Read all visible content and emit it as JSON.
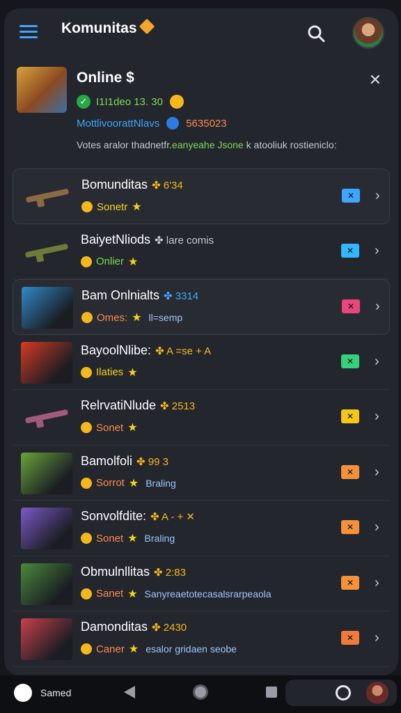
{
  "header": {
    "title": "Komunitas",
    "menu_icon": "hamburger-menu-icon",
    "search_icon": "search-icon",
    "avatar": "user-avatar"
  },
  "online_card": {
    "title": "Online $",
    "stat": "I1I1deo 13. 30",
    "sub_blue": "MottlivoorattNlavs",
    "sub_orange": "5635023",
    "desc_main": "Votes aralor thadnetfr.",
    "desc_green": "eanyeahe Jsone",
    "desc_tail": " k atooliuk rostieniclo:"
  },
  "rows": [
    {
      "title": "Bomunditas",
      "badge": "✤ 6'34",
      "badge_color": "#f5b81c",
      "sub": "Sonetr",
      "sub_color": "#f5d21c",
      "extra": "",
      "tag": "✕",
      "tag_color": "#3ea6ff",
      "thumb": "weapon",
      "thumb_color": "#8b6a45",
      "boxed": true
    },
    {
      "title": "BaiyetNliods",
      "badge": "✤ lare comis",
      "badge_color": "#c5c8d0",
      "sub": "Onlier",
      "sub_color": "#7ed957",
      "extra": "",
      "tag": "✕",
      "tag_color": "#34b7ff",
      "thumb": "weapon",
      "thumb_color": "#6f7a3a",
      "boxed": false
    },
    {
      "title": "Bam Onlnialts",
      "badge": "✤ 3314",
      "badge_color": "#3ea6ff",
      "sub": "Omes:",
      "sub_color": "#ff8a4c",
      "extra": "ll=semp",
      "tag": "✕",
      "tag_color": "#e8467c",
      "thumb": "art",
      "thumb_color": "#2f8ac8",
      "boxed": true
    },
    {
      "title": "BayoolNlibe:",
      "badge": "✤ A =se + A",
      "badge_color": "#f5b81c",
      "sub": "Ilaties",
      "sub_color": "#f5d21c",
      "extra": "",
      "tag": "✕",
      "tag_color": "#36d07a",
      "thumb": "art",
      "thumb_color": "#d63a24",
      "boxed": false
    },
    {
      "title": "RelrvatiNlude",
      "badge": "✤ 2513",
      "badge_color": "#f5b81c",
      "sub": "Sonet",
      "sub_color": "#ff8a4c",
      "extra": "",
      "tag": "✕",
      "tag_color": "#f5c518",
      "thumb": "weapon",
      "thumb_color": "#a05a7a",
      "boxed": false
    },
    {
      "title": "Bamolfoli",
      "badge": "✤ 99 3",
      "badge_color": "#f5b81c",
      "sub": "Sorrot",
      "sub_color": "#ff8a4c",
      "extra": "Braling",
      "tag": "✕",
      "tag_color": "#f5913a",
      "thumb": "art",
      "thumb_color": "#6aa43a",
      "boxed": false
    },
    {
      "title": "Sonvolfdite:",
      "badge": "✤ A - + ✕",
      "badge_color": "#f5b81c",
      "sub": "Sonet",
      "sub_color": "#ff8a4c",
      "extra": "Braling",
      "tag": "✕",
      "tag_color": "#f5913a",
      "thumb": "art",
      "thumb_color": "#7a5ac8",
      "boxed": false
    },
    {
      "title": "Obmulnllitas",
      "badge": "✤ 2:83",
      "badge_color": "#f5b81c",
      "sub": "Sanet",
      "sub_color": "#ff8a4c",
      "extra": "Sanyreaetotecasalsrarpeaola",
      "tag": "✕",
      "tag_color": "#f5913a",
      "thumb": "art",
      "thumb_color": "#4a8a3a",
      "boxed": false
    },
    {
      "title": "Damonditas",
      "badge": "✤ 2430",
      "badge_color": "#f5b81c",
      "sub": "Caner",
      "sub_color": "#ff8a4c",
      "extra": "esalor gridaen seobe",
      "tag": "✕",
      "tag_color": "#f07a3a",
      "thumb": "art",
      "thumb_color": "#c8404a",
      "boxed": false
    }
  ],
  "bottom_nav": {
    "brand_label": "Samed"
  }
}
